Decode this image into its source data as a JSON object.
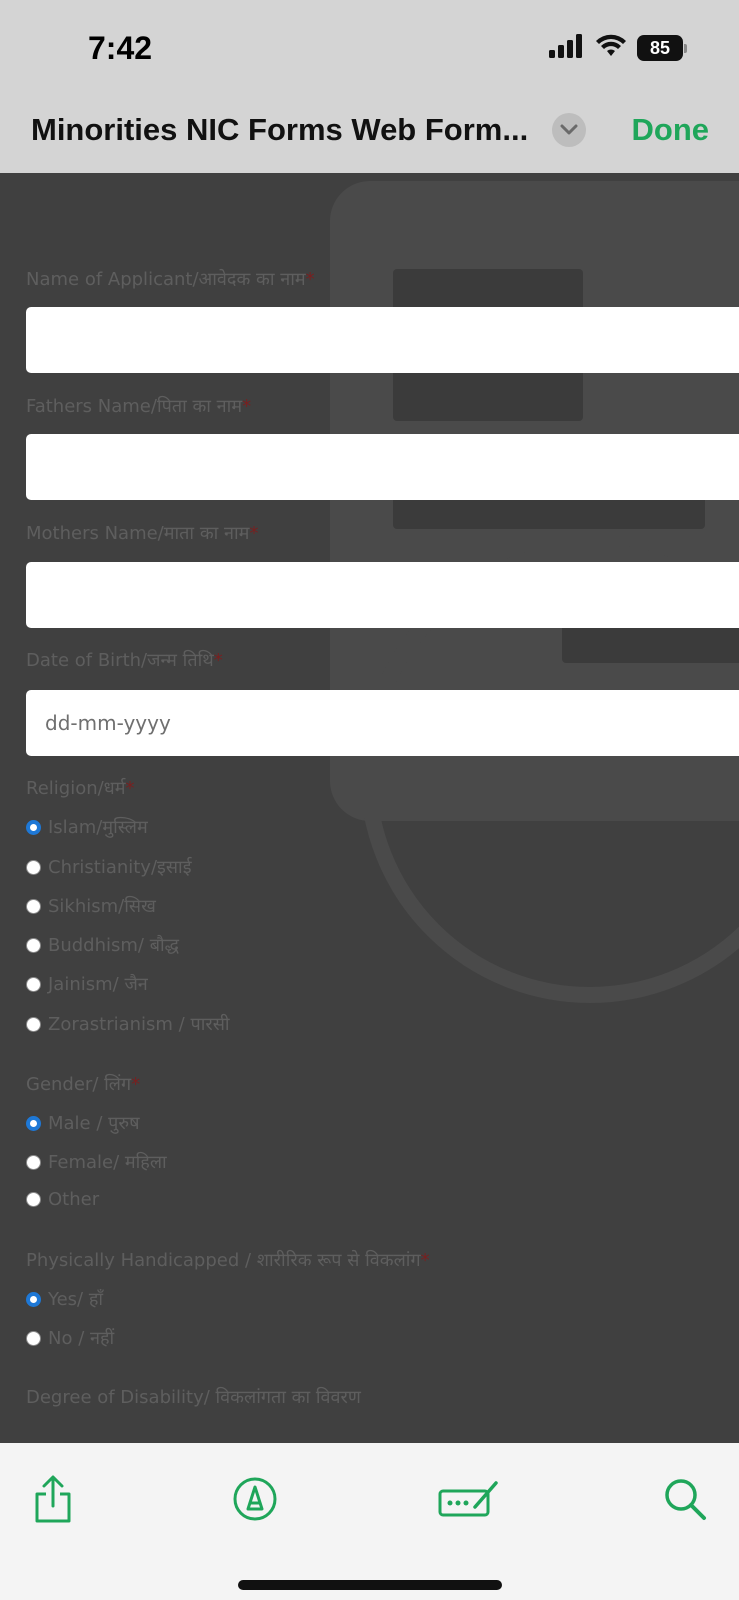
{
  "status_bar": {
    "time": "7:42",
    "battery": "85"
  },
  "title_bar": {
    "title": "Minorities NIC Forms Web Form...",
    "done_label": "Done",
    "accent_color": "#1fa65a"
  },
  "form": {
    "applicant_name": {
      "label": "Name of Applicant/आवेदक का नाम",
      "required": "*",
      "value": ""
    },
    "father_name": {
      "label": "Fathers Name/पिता का नाम",
      "required": "*",
      "value": ""
    },
    "mother_name": {
      "label": "Mothers Name/माता का नाम",
      "required": "*",
      "value": ""
    },
    "dob": {
      "label": "Date of Birth/जन्म तिथि",
      "required": "*",
      "placeholder": "dd-mm-yyyy"
    },
    "religion": {
      "label": "Religion/धर्म",
      "required": "*",
      "selected": "Islam/मुस्लिम",
      "options": [
        "Islam/मुस्लिम",
        "Christianity/इसाई",
        "Sikhism/सिख",
        "Buddhism/ बौद्ध",
        "Jainism/ जैन",
        "Zorastrianism / पारसी"
      ]
    },
    "gender": {
      "label": "Gender/ लिंग",
      "required": "*",
      "selected": "Male / पुरुष",
      "options": [
        "Male / पुरुष",
        "Female/ महिला",
        "Other"
      ]
    },
    "handicapped": {
      "label": "Physically Handicapped / शारीरिक रूप से विकलांग",
      "required": "*",
      "selected": "Yes/ हाँ",
      "options": [
        "Yes/ हाँ",
        "No / नहीं"
      ]
    },
    "disability_degree": {
      "label": "Degree of Disability/ विकलांगता का विवरण"
    }
  },
  "toolbar": {
    "icons": [
      "share-icon",
      "markup-icon",
      "form-fill-icon",
      "search-icon"
    ]
  }
}
